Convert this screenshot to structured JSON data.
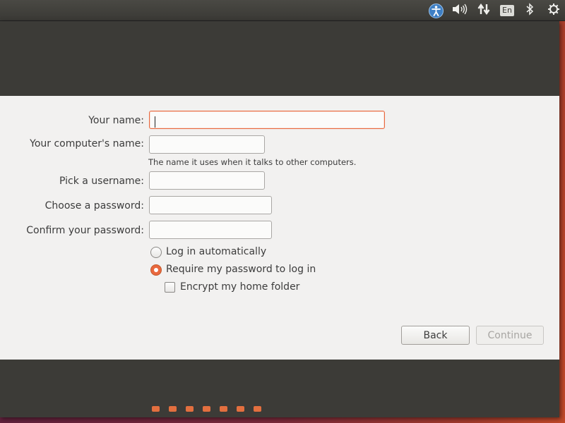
{
  "panel": {
    "language_indicator": "En",
    "icons": [
      "accessibility-icon",
      "volume-icon",
      "network-icon",
      "language-icon",
      "bluetooth-icon",
      "settings-icon"
    ]
  },
  "form": {
    "name_label": "Your name:",
    "name_value": "",
    "computer_label": "Your computer's name:",
    "computer_value": "",
    "computer_hint": "The name it uses when it talks to other computers.",
    "username_label": "Pick a username:",
    "username_value": "",
    "password_label": "Choose a password:",
    "password_value": "",
    "confirm_label": "Confirm your password:",
    "confirm_value": ""
  },
  "options": {
    "login_auto": "Log in automatically",
    "login_password": "Require my password to log in",
    "encrypt_home": "Encrypt my home folder",
    "selected": "login_password",
    "encrypt_checked": false
  },
  "buttons": {
    "back": "Back",
    "continue": "Continue"
  },
  "progress": {
    "total_steps": 7
  },
  "colors": {
    "accent": "#e9683e",
    "panel": "#3c3b37",
    "content": "#f2f1f0"
  }
}
